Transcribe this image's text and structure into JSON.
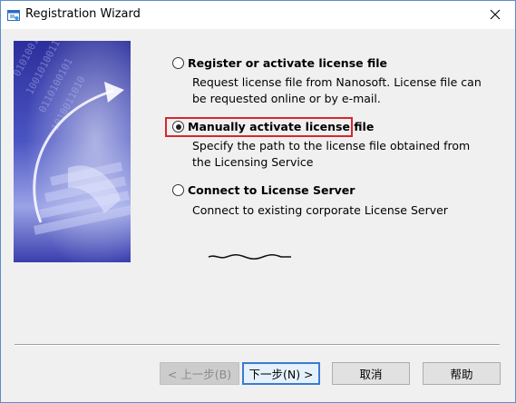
{
  "window": {
    "title": "Registration Wizard"
  },
  "options": [
    {
      "label": "Register or activate license file",
      "description": "Request license file from Nanosoft. License file can be requested online or by e-mail.",
      "checked": false
    },
    {
      "label": "Manually activate license file",
      "description": "Specify the path to the license file obtained from the Licensing Service",
      "checked": true
    },
    {
      "label": "Connect to License Server",
      "description": "Connect to existing corporate License Server",
      "checked": false
    }
  ],
  "buttons": {
    "back": "< 上一步(B)",
    "next": "下一步(N) >",
    "cancel": "取消",
    "help": "帮助"
  },
  "colors": {
    "highlight": "#d8262d",
    "window_bg": "#f0f0f0",
    "default_button_border": "#3a7bd5"
  },
  "icons": {
    "title": "wizard-app-icon",
    "close": "close-icon",
    "side": "arrow-data-keyboard-illustration"
  }
}
